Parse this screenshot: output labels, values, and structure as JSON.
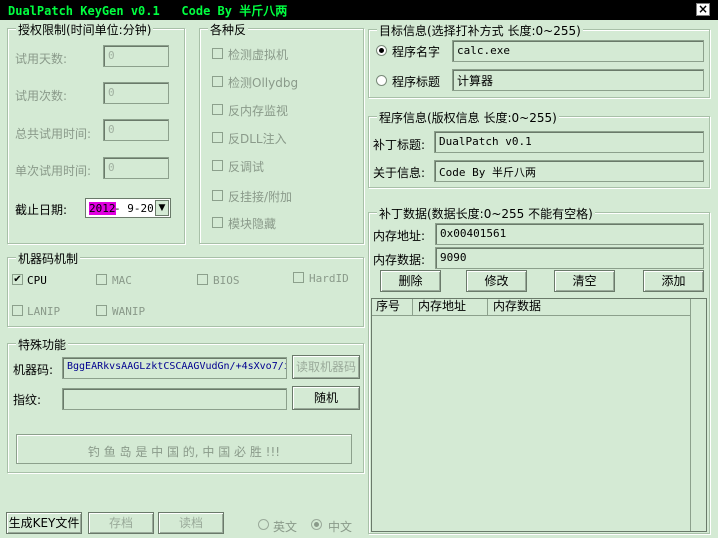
{
  "window": {
    "title": "DualPatch KeyGen v0.1   Code By 半斤八两",
    "close": "×"
  },
  "auth": {
    "legend": "授权限制(时间单位:分钟)",
    "trial_days": {
      "label": "试用天数:",
      "value": "0"
    },
    "trial_count": {
      "label": "试用次数:",
      "value": "0"
    },
    "total_time": {
      "label": "总共试用时间:",
      "value": "0"
    },
    "single_time": {
      "label": "单次试用时间:",
      "value": "0"
    },
    "deadline": {
      "label": "截止日期:",
      "year": "2012",
      "rest": "- 9-20",
      "arrow": "▼"
    }
  },
  "anti": {
    "legend": "各种反",
    "items": [
      "检测虚拟机",
      "检测Ollydbg",
      "反内存监视",
      "反DLL注入",
      "反调试",
      "反挂接/附加",
      "模块隐藏"
    ]
  },
  "machine": {
    "legend": "机器码机制",
    "items": [
      {
        "label": "CPU",
        "checked": "✔"
      },
      {
        "label": "MAC",
        "checked": ""
      },
      {
        "label": "BIOS",
        "checked": ""
      },
      {
        "label": "HardID",
        "checked": ""
      },
      {
        "label": "LANIP",
        "checked": ""
      },
      {
        "label": "WANIP",
        "checked": ""
      }
    ]
  },
  "special": {
    "legend": "特殊功能",
    "code_label": "机器码:",
    "code_value": "BggEARkvsAAGLzktCSCAAGVudGn/+4sXvo7/i",
    "read_button": "读取机器码",
    "fingerprint_label": "指纹:",
    "fingerprint_value": "",
    "random_button": "随机",
    "banner": "钓 鱼 岛 是 中 国 的, 中 国 必 胜 !!!"
  },
  "target": {
    "legend": "目标信息(选择打补方式 长度:0~255)",
    "name_label": "程序名字",
    "name_value": "calc.exe",
    "caption_label": "程序标题",
    "caption_value": "计算器"
  },
  "program": {
    "legend": "程序信息(版权信息 长度:0~255)",
    "title_label": "补丁标题:",
    "title_value": "DualPatch v0.1",
    "about_label": "关于信息:",
    "about_value": "Code By 半斤八两"
  },
  "patch": {
    "legend": "补丁数据(数据长度:0~255 不能有空格)",
    "addr_label": "内存地址:",
    "addr_value": "0x00401561",
    "data_label": "内存数据:",
    "data_value": "9090",
    "buttons": {
      "delete": "删除",
      "modify": "修改",
      "clear": "清空",
      "add": "添加"
    },
    "columns": [
      "序号",
      "内存地址",
      "内存数据"
    ]
  },
  "bottom": {
    "generate": "生成KEY文件",
    "save": "存档",
    "load": "读档",
    "lang_en": "英文",
    "lang_zh": "中文"
  }
}
